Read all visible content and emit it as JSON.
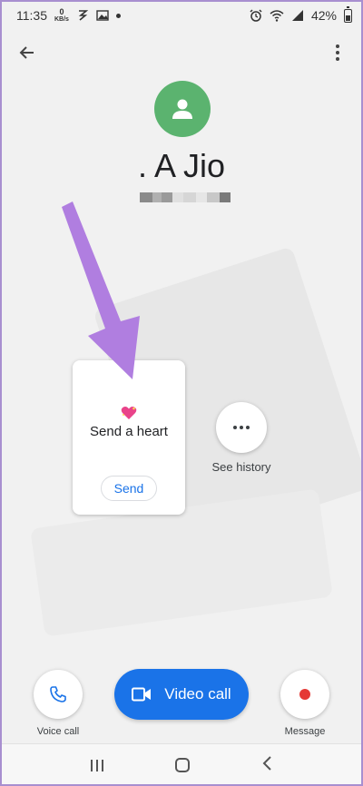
{
  "status_bar": {
    "time": "11:35",
    "data_rate_value": "0",
    "data_rate_unit": "KB/s",
    "battery": "42%"
  },
  "contact": {
    "name": ". A Jio"
  },
  "heart_card": {
    "label": "Send a heart",
    "send_label": "Send"
  },
  "history": {
    "label": "See history"
  },
  "actions": {
    "voice_call_label": "Voice call",
    "video_call_label": "Video call",
    "message_label": "Message"
  },
  "colors": {
    "avatar": "#5bb36f",
    "primary": "#1a73e8",
    "record": "#e53935",
    "annotation_arrow": "#b07ee0"
  },
  "icons": {
    "back": "arrow-left-icon",
    "menu": "more-vert-icon",
    "avatar": "person-icon",
    "voice": "phone-icon",
    "video": "videocam-icon",
    "message": "record-dot-icon"
  }
}
